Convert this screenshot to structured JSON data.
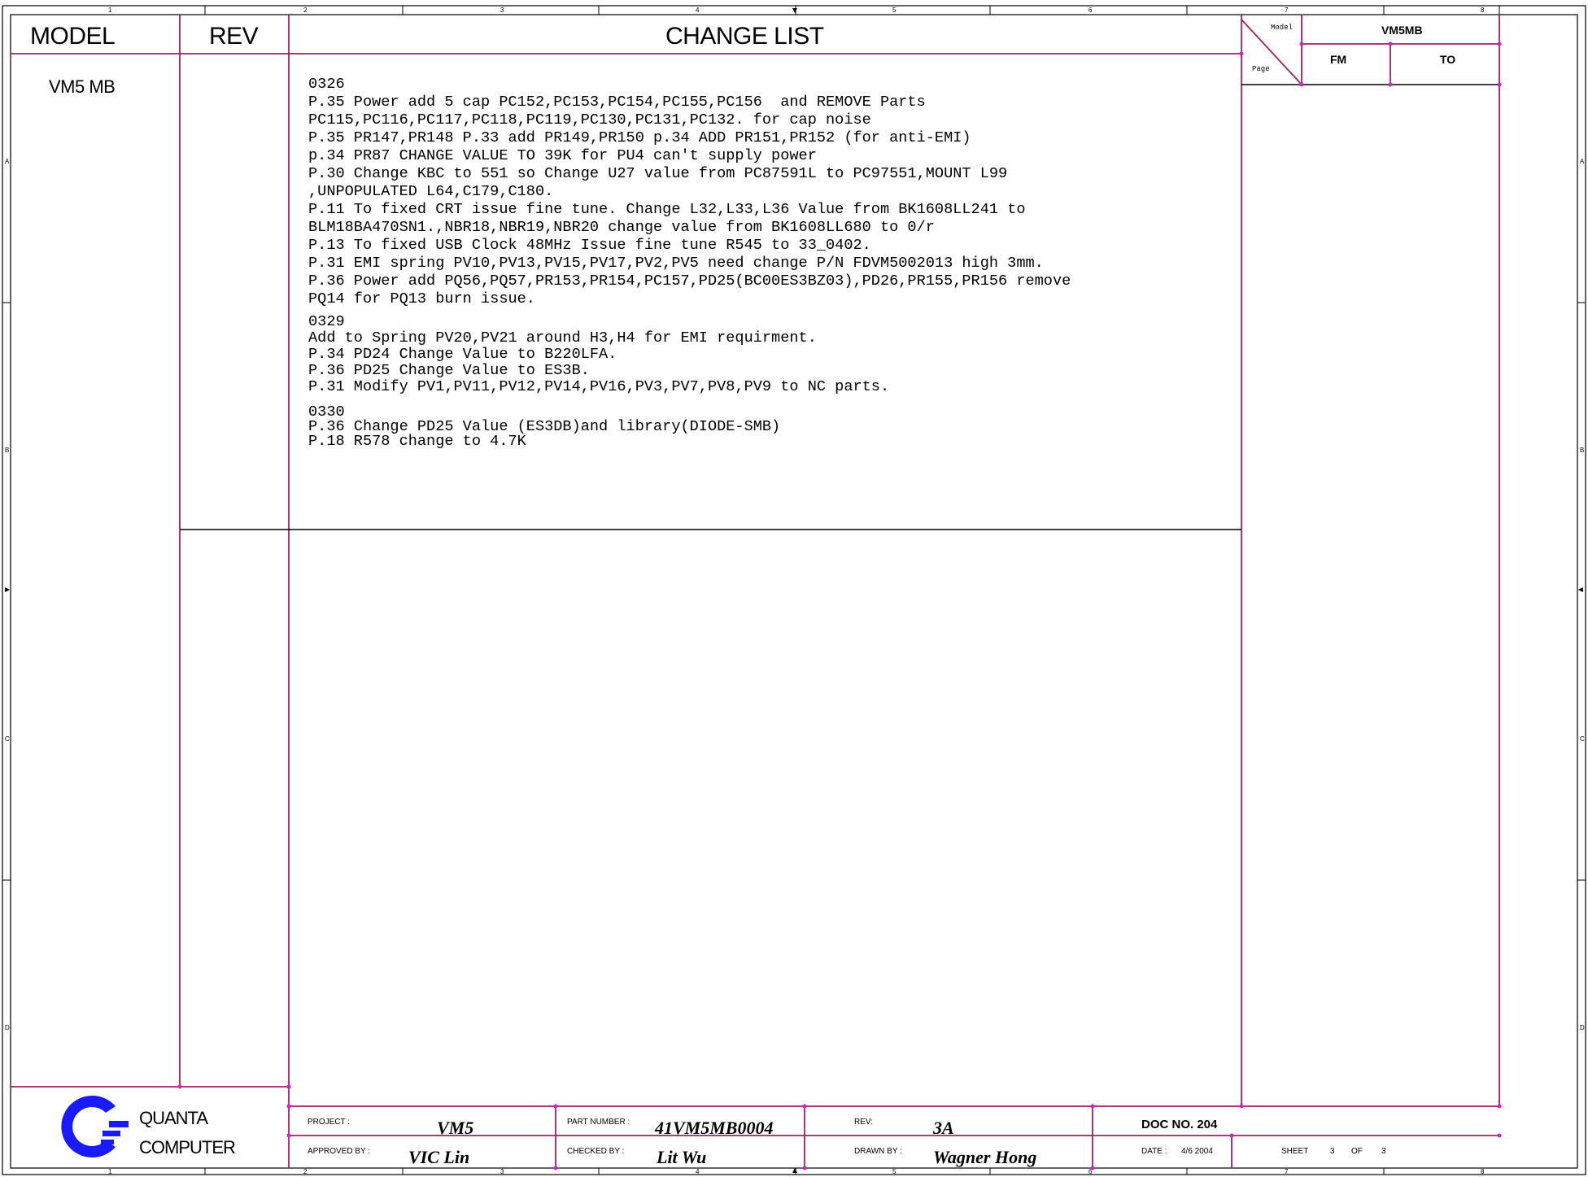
{
  "headers": {
    "model": "MODEL",
    "rev": "REV",
    "title": "CHANGE LIST"
  },
  "model_value": "VM5 MB",
  "corner_box": {
    "model_label": "Model",
    "page_label": "Page",
    "model_value": "VM5MB",
    "fm": "FM",
    "to": "TO"
  },
  "changes": [
    {
      "date": "0326",
      "lines": [
        "P.35 Power add 5 cap PC152,PC153,PC154,PC155,PC156  and REMOVE Parts",
        "PC115,PC116,PC117,PC118,PC119,PC130,PC131,PC132. for cap noise",
        "P.35 PR147,PR148 P.33 add PR149,PR150 p.34 ADD PR151,PR152 (for anti-EMI)",
        "p.34 PR87 CHANGE VALUE TO 39K for PU4 can't supply power",
        "P.30 Change KBC to 551 so Change U27 value from PC87591L to PC97551,MOUNT L99",
        ",UNPOPULATED L64,C179,C180.",
        "P.11 To fixed CRT issue fine tune. Change L32,L33,L36 Value from BK1608LL241 to",
        "BLM18BA470SN1.,NBR18,NBR19,NBR20 change value from BK1608LL680 to 0/r",
        "P.13 To fixed USB Clock 48MHz Issue fine tune R545 to 33_0402.",
        "P.31 EMI spring PV10,PV13,PV15,PV17,PV2,PV5 need change P/N FDVM5002013 high 3mm.",
        "P.36 Power add PQ56,PQ57,PR153,PR154,PC157,PD25(BC00ES3BZ03),PD26,PR155,PR156 remove",
        "PQ14 for PQ13 burn issue."
      ]
    },
    {
      "date": "0329",
      "lines": [
        "Add to Spring PV20,PV21 around H3,H4 for EMI requirment.",
        "P.34 PD24 Change Value to B220LFA.",
        "P.36 PD25 Change Value to ES3B.",
        "P.31 Modify PV1,PV11,PV12,PV14,PV16,PV3,PV7,PV8,PV9 to NC parts."
      ]
    },
    {
      "date": "0330",
      "lines": [
        "P.36 Change PD25 Value (ES3DB)and library(DIODE-SMB)",
        "P.18 R578 change to 4.7K"
      ]
    }
  ],
  "company": {
    "line1": "QUANTA",
    "line2": "COMPUTER"
  },
  "title_block": {
    "project_label": "PROJECT :",
    "project_value": "VM5",
    "part_label": "PART NUMBER :",
    "part_value": "41VM5MB0004",
    "rev_label": "REV:",
    "rev_value": "3A",
    "doc_no": "DOC NO. 204",
    "approved_label": "APPROVED BY :",
    "approved_value": "VIC Lin",
    "checked_label": "CHECKED BY :",
    "checked_value": "Lit Wu",
    "drawn_label": "DRAWN BY :",
    "drawn_value": "Wagner Hong",
    "date_label": "DATE :",
    "date_value": "4/6 2004",
    "sheet_label": "SHEET",
    "sheet_num": "3",
    "of_label": "OF",
    "sheet_total": "3"
  },
  "border_cols": [
    "1",
    "2",
    "3",
    "4",
    "5",
    "6",
    "7",
    "8"
  ],
  "border_rows": [
    "A",
    "B",
    "C",
    "D"
  ],
  "colors": {
    "grid": "#a0206a",
    "frame": "#000000",
    "logo": "#1a1aff"
  }
}
